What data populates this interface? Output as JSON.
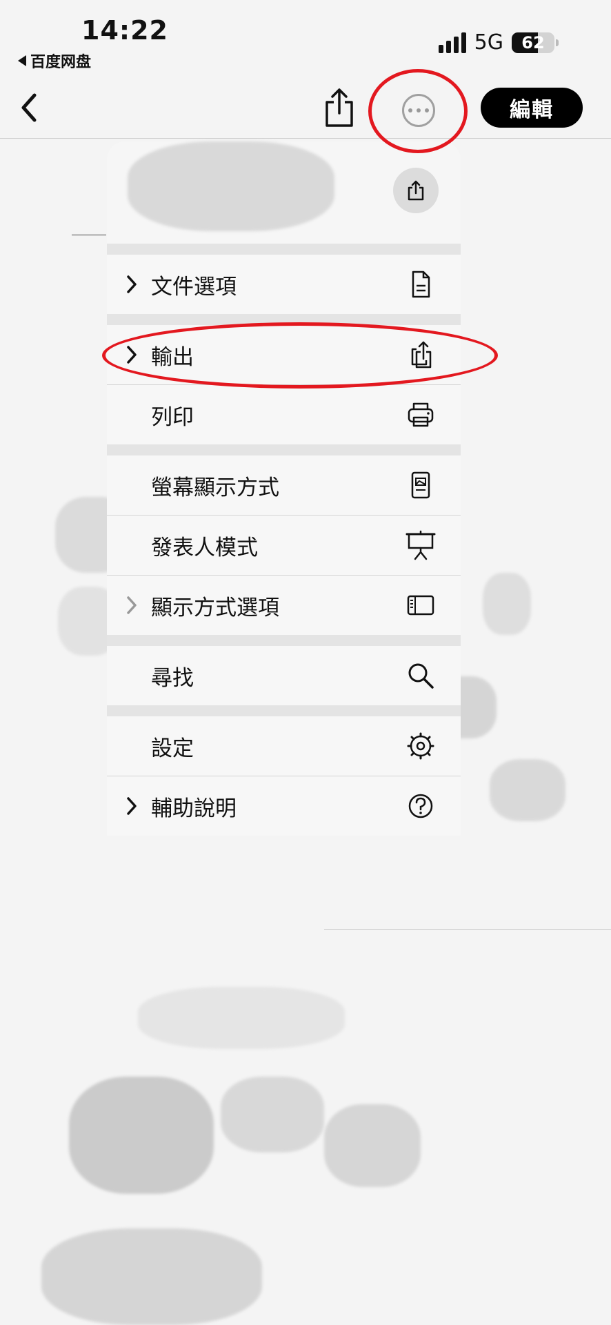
{
  "status_bar": {
    "time": "14:22",
    "back_app": "百度网盘",
    "network": "5G",
    "battery": "62",
    "battery_level": 0.62
  },
  "toolbar": {
    "edit_label": "編輯",
    "icons": [
      "chevron-left-icon",
      "share-icon",
      "more-icon"
    ]
  },
  "menu": {
    "header_action_icon": "share-icon",
    "groups": [
      [
        {
          "label": "文件選項",
          "chevron": true,
          "icon": "document-icon"
        }
      ],
      [
        {
          "label": "輸出",
          "chevron": true,
          "icon": "export-icon"
        },
        {
          "label": "列印",
          "chevron": false,
          "icon": "printer-icon"
        }
      ],
      [
        {
          "label": "螢幕顯示方式",
          "chevron": false,
          "icon": "screen-display-icon"
        },
        {
          "label": "發表人模式",
          "chevron": false,
          "icon": "presenter-icon"
        },
        {
          "label": "顯示方式選項",
          "chevron": true,
          "icon": "sidebar-icon"
        }
      ],
      [
        {
          "label": "尋找",
          "chevron": false,
          "icon": "search-icon"
        }
      ],
      [
        {
          "label": "設定",
          "chevron": false,
          "icon": "gear-icon"
        },
        {
          "label": "輔助說明",
          "chevron": true,
          "icon": "help-icon"
        }
      ]
    ]
  },
  "annotation_color": "#e3181f"
}
